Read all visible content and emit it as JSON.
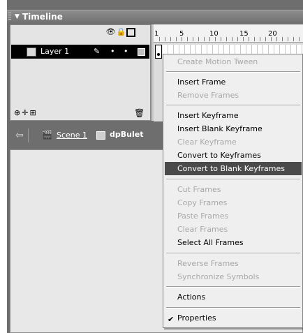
{
  "timeline": {
    "title": "Timeline",
    "layer": {
      "name": "Layer 1"
    },
    "ruler_ticks": [
      "1",
      "5",
      "10",
      "15",
      "20"
    ]
  },
  "editbar": {
    "scene": "Scene 1",
    "symbol": "dpBulet"
  },
  "menu": {
    "items": [
      {
        "label": "Create Motion Tween",
        "enabled": false
      },
      {
        "label": "Insert Frame",
        "enabled": true
      },
      {
        "label": "Remove Frames",
        "enabled": false
      },
      {
        "label": "Insert Keyframe",
        "enabled": true
      },
      {
        "label": "Insert Blank Keyframe",
        "enabled": true
      },
      {
        "label": "Clear Keyframe",
        "enabled": false
      },
      {
        "label": "Convert to Keyframes",
        "enabled": true
      },
      {
        "label": "Convert to Blank Keyframes",
        "enabled": true,
        "highlighted": true
      },
      {
        "label": "Cut Frames",
        "enabled": false
      },
      {
        "label": "Copy Frames",
        "enabled": false
      },
      {
        "label": "Paste Frames",
        "enabled": false
      },
      {
        "label": "Clear Frames",
        "enabled": false
      },
      {
        "label": "Select All Frames",
        "enabled": true
      },
      {
        "label": "Reverse Frames",
        "enabled": false
      },
      {
        "label": "Synchronize Symbols",
        "enabled": false
      },
      {
        "label": "Actions",
        "enabled": true
      },
      {
        "label": "Properties",
        "enabled": true,
        "checked": true
      }
    ]
  },
  "colors": {
    "chrome": "#6e6e6e",
    "menu_highlight": "#4a4a4a",
    "disabled_text": "#a8a8a8"
  }
}
